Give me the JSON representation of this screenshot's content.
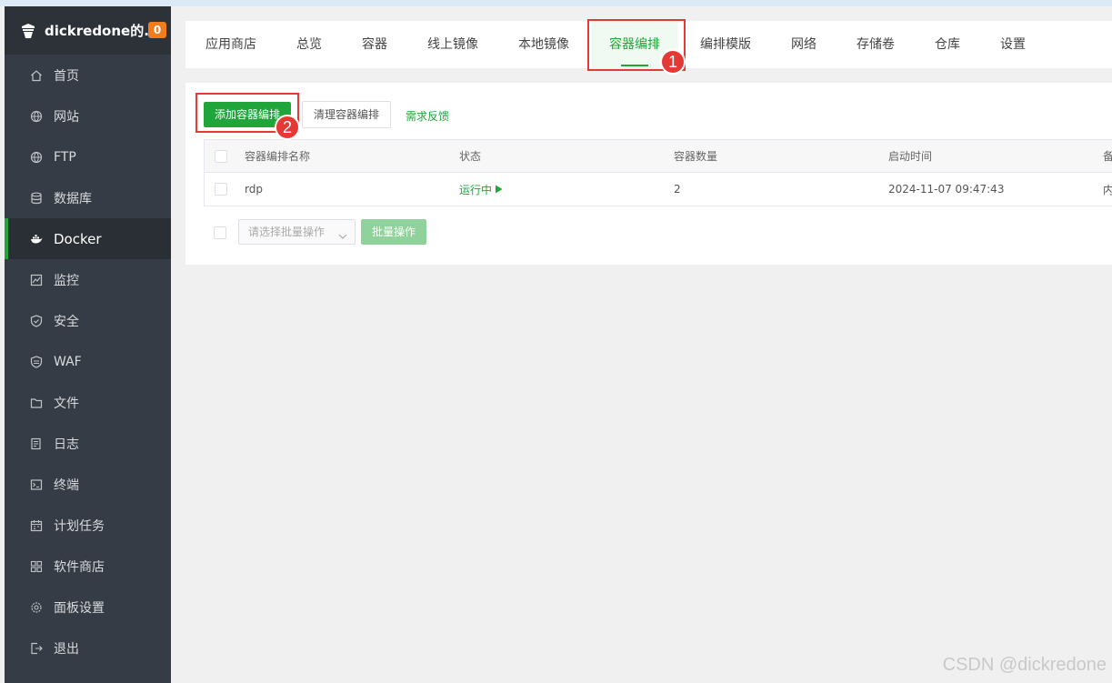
{
  "sidebar": {
    "brand": "dickredone的...",
    "badge": "0",
    "items": [
      {
        "label": "首页",
        "icon": "home-icon"
      },
      {
        "label": "网站",
        "icon": "globe-icon"
      },
      {
        "label": "FTP",
        "icon": "globe-icon"
      },
      {
        "label": "数据库",
        "icon": "database-icon"
      },
      {
        "label": "Docker",
        "icon": "docker-icon"
      },
      {
        "label": "监控",
        "icon": "monitor-icon"
      },
      {
        "label": "安全",
        "icon": "shield-icon"
      },
      {
        "label": "WAF",
        "icon": "waf-shield-icon"
      },
      {
        "label": "文件",
        "icon": "folder-icon"
      },
      {
        "label": "日志",
        "icon": "log-icon"
      },
      {
        "label": "终端",
        "icon": "terminal-icon"
      },
      {
        "label": "计划任务",
        "icon": "calendar-icon"
      },
      {
        "label": "软件商店",
        "icon": "apps-icon"
      },
      {
        "label": "面板设置",
        "icon": "gear-icon"
      },
      {
        "label": "退出",
        "icon": "logout-icon"
      }
    ],
    "active_index": 4
  },
  "tabs": [
    "应用商店",
    "总览",
    "容器",
    "线上镜像",
    "本地镜像",
    "容器编排",
    "编排模版",
    "网络",
    "存储卷",
    "仓库",
    "设置"
  ],
  "active_tab": 5,
  "toolbar": {
    "add_label": "添加容器编排",
    "clean_label": "清理容器编排",
    "feedback_label": "需求反馈"
  },
  "table": {
    "headers": [
      "容器编排名称",
      "状态",
      "容器数量",
      "启动时间",
      "备"
    ],
    "rows": [
      {
        "name": "rdp",
        "status": "运行中",
        "count": "2",
        "time": "2024-11-07 09:47:43",
        "extra": "内"
      }
    ]
  },
  "batch": {
    "placeholder": "请选择批量操作",
    "button": "批量操作"
  },
  "annotations": [
    "1",
    "2"
  ],
  "watermark": "CSDN @dickredone",
  "colors": {
    "accent": "#20a53a",
    "sidebar": "#363c45",
    "annotation": "#e53935",
    "badge": "#f07c1e"
  }
}
